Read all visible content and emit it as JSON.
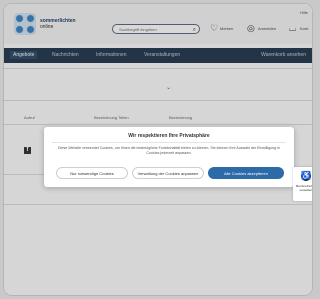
{
  "header": {
    "logo_line1": "sommerlichten",
    "logo_line2": "online",
    "search_placeholder": "Suchbegriff eingeben",
    "icons": [
      {
        "name": "heart-icon",
        "label": "Merken"
      },
      {
        "name": "user-icon",
        "label": "Anmelden"
      },
      {
        "name": "cart-icon",
        "label": "Korb"
      }
    ],
    "top_link": "Hilfe"
  },
  "nav": {
    "items": [
      "Angebote",
      "Nachrichten",
      "Informationen",
      "Veranstaltungen"
    ],
    "right_label": "Warenkorb ansehen"
  },
  "table": {
    "headers": [
      "Aufruf",
      "Bezeichnung Teilen",
      "Bezeichnung"
    ]
  },
  "consent": {
    "title": "Wir respektieren Ihre Privatsphäre",
    "text": "Diese Website verwendet Cookies, um Ihnen die bestmögliche Funktionalität bieten zu können. Sie können Ihre Auswahl der Einwilligung in Cookies jederzeit anpassen.",
    "buttons": {
      "reject": "Nur notwendige Cookies",
      "settings": "Verwaltung der Cookies anpassen",
      "accept": "Alle Cookies akzeptieren"
    }
  },
  "accessibility": {
    "label": "Barrierefreiheit einstellen"
  },
  "colors": {
    "nav_bg": "#23374e",
    "primary_button": "#2d6aa8",
    "brand": "#3a83c4"
  }
}
